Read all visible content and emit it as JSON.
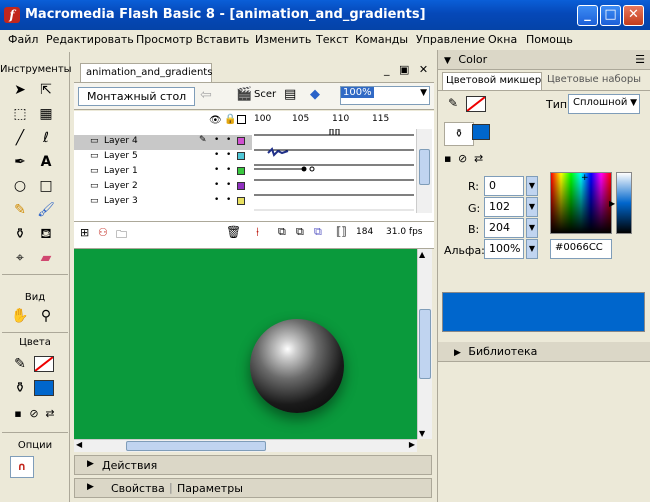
{
  "window": {
    "title": "Macromedia Flash Basic 8 - [animation_and_gradients]",
    "app_icon": "flash-icon"
  },
  "menu": [
    "Файл",
    "Редактировать",
    "Просмотр",
    "Вставить",
    "Изменить",
    "Текст",
    "Команды",
    "Управление",
    "Окна",
    "Помощь"
  ],
  "tools": {
    "title": "Инструменты",
    "view_label": "Вид",
    "colors_label": "Цвета",
    "options_label": "Опции"
  },
  "document": {
    "tab_name": "animation_and_gradients",
    "scene_button": "Монтажный стол",
    "scene_label": "Scer",
    "zoom_value": "100%",
    "layers": [
      "Layer 4",
      "Layer 5",
      "Layer 1",
      "Layer 2",
      "Layer 3"
    ],
    "frame_ticks": [
      "100",
      "105",
      "110",
      "115"
    ],
    "current_frame": "184",
    "fps": "31.0 fps"
  },
  "panels": {
    "actions": "Действия",
    "properties": "Свойства",
    "parameters": "Параметры",
    "library": "Библиотека"
  },
  "color": {
    "panel_title": "Color",
    "tab_mixer": "Цветовой микшер",
    "tab_swatches": "Цветовые наборы",
    "type_label": "Тип:",
    "type_value": "Сплошной",
    "r_label": "R:",
    "g_label": "G:",
    "b_label": "B:",
    "alpha_label": "Альфа:",
    "r_value": "0",
    "g_value": "102",
    "b_value": "204",
    "alpha_value": "100%",
    "hex_value": "#0066CC",
    "current_color": "#0066CC",
    "stage_color": "#0a9a3c"
  }
}
